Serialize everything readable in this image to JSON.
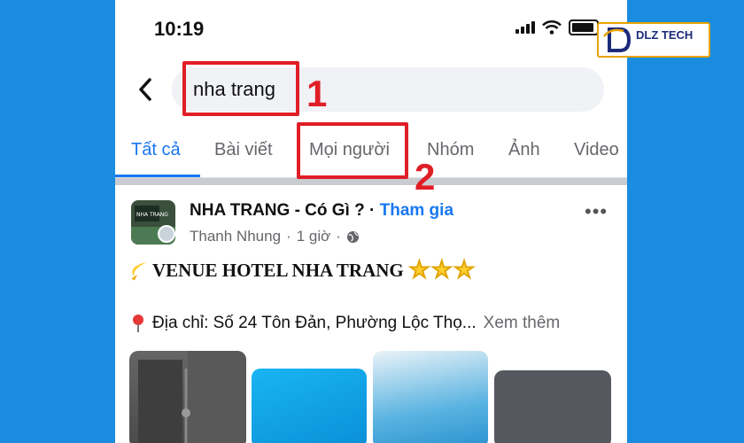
{
  "status_bar": {
    "time": "10:19"
  },
  "search": {
    "query": "nha trang"
  },
  "tabs": [
    {
      "label": "Tất cả",
      "active": true
    },
    {
      "label": "Bài viết"
    },
    {
      "label": "Mọi người"
    },
    {
      "label": "Nhóm"
    },
    {
      "label": "Ảnh"
    },
    {
      "label": "Video"
    }
  ],
  "post": {
    "group_name": "NHA TRANG - Có Gì ?",
    "separator": "·",
    "join_label": "Tham gia",
    "author": "Thanh Nhung",
    "time": "1 giờ",
    "title": "VENUE HOTEL NHA TRANG",
    "stars": "★★★",
    "address": "Địa chỉ: Số 24 Tôn Đản, Phường Lộc Thọ...",
    "see_more": "Xem thêm",
    "thumb_caption": "NHA TRANG"
  },
  "annotations": {
    "step1": "1",
    "step2": "2"
  },
  "logo": {
    "text": "DLZ TECH"
  },
  "colors": {
    "accent": "#1877f2",
    "annotation": "#e01e26",
    "background": "#1a8de0"
  }
}
